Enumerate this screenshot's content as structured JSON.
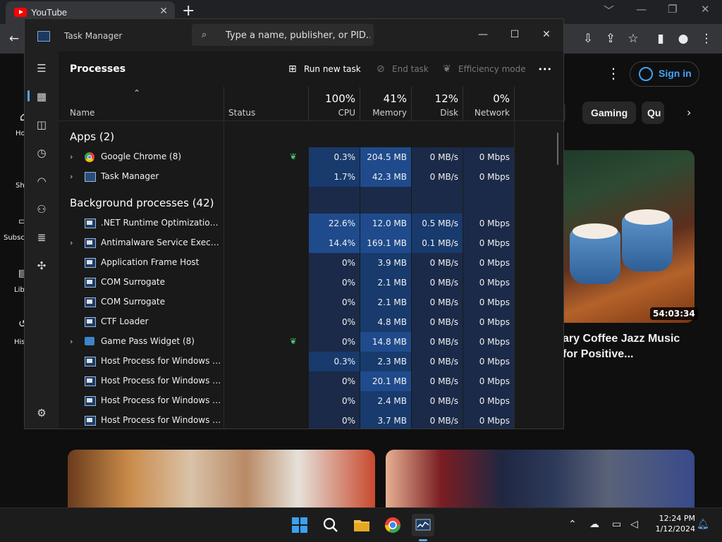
{
  "browser": {
    "tab_title": "YouTube",
    "tab_close": "✕",
    "new_tab": "+",
    "window_controls": [
      "﹀",
      "—",
      "❐",
      "✕"
    ]
  },
  "youtube": {
    "sidebar": [
      "Ho",
      "Sh",
      "Subsc",
      "Lib",
      "His"
    ],
    "signin": "Sign in",
    "chips": [
      "g",
      "Gaming",
      "Qu"
    ],
    "video": {
      "duration": "54:03:34",
      "title": "ary Coffee Jazz Music for Positive..."
    }
  },
  "taskmanager": {
    "title": "Task Manager",
    "search_placeholder": "Type a name, publisher, or PID...",
    "window_controls": [
      "—",
      "☐",
      "✕"
    ],
    "section": "Processes",
    "commands": {
      "run_new_task": "Run new task",
      "end_task": "End task",
      "efficiency_mode": "Efficiency mode",
      "more": "•••"
    },
    "headers": {
      "name": "Name",
      "status": "Status",
      "cpu_pct": "100%",
      "cpu": "CPU",
      "mem_pct": "41%",
      "mem": "Memory",
      "disk_pct": "12%",
      "disk": "Disk",
      "net_pct": "0%",
      "net": "Network"
    },
    "groups": {
      "apps": "Apps (2)",
      "background": "Background processes (42)"
    },
    "apps": [
      {
        "name": "Google Chrome (8)",
        "expand": true,
        "icon": "chrome-icon",
        "eco": true,
        "cpu": "0.3%",
        "mem": "204.5 MB",
        "disk": "0 MB/s",
        "net": "0 Mbps"
      },
      {
        "name": "Task Manager",
        "expand": true,
        "icon": "task-manager-icon",
        "eco": false,
        "cpu": "1.7%",
        "mem": "42.3 MB",
        "disk": "0 MB/s",
        "net": "0 Mbps"
      }
    ],
    "background": [
      {
        "name": ".NET Runtime Optimization Se...",
        "expand": false,
        "icon": "win",
        "eco": false,
        "cpu": "22.6%",
        "mem": "12.0 MB",
        "disk": "0.5 MB/s",
        "net": "0 Mbps"
      },
      {
        "name": "Antimalware Service Executable",
        "expand": true,
        "icon": "win",
        "eco": false,
        "cpu": "14.4%",
        "mem": "169.1 MB",
        "disk": "0.1 MB/s",
        "net": "0 Mbps"
      },
      {
        "name": "Application Frame Host",
        "expand": false,
        "icon": "win",
        "eco": false,
        "cpu": "0%",
        "mem": "3.9 MB",
        "disk": "0 MB/s",
        "net": "0 Mbps"
      },
      {
        "name": "COM Surrogate",
        "expand": false,
        "icon": "win",
        "eco": false,
        "cpu": "0%",
        "mem": "2.1 MB",
        "disk": "0 MB/s",
        "net": "0 Mbps"
      },
      {
        "name": "COM Surrogate",
        "expand": false,
        "icon": "win",
        "eco": false,
        "cpu": "0%",
        "mem": "2.1 MB",
        "disk": "0 MB/s",
        "net": "0 Mbps"
      },
      {
        "name": "CTF Loader",
        "expand": false,
        "icon": "win",
        "eco": false,
        "cpu": "0%",
        "mem": "4.8 MB",
        "disk": "0 MB/s",
        "net": "0 Mbps"
      },
      {
        "name": "Game Pass Widget (8)",
        "expand": true,
        "icon": "gp",
        "eco": true,
        "cpu": "0%",
        "mem": "14.8 MB",
        "disk": "0 MB/s",
        "net": "0 Mbps"
      },
      {
        "name": "Host Process for Windows Tasks",
        "expand": false,
        "icon": "win",
        "eco": false,
        "cpu": "0.3%",
        "mem": "2.3 MB",
        "disk": "0 MB/s",
        "net": "0 Mbps"
      },
      {
        "name": "Host Process for Windows Tasks",
        "expand": false,
        "icon": "win",
        "eco": false,
        "cpu": "0%",
        "mem": "20.1 MB",
        "disk": "0 MB/s",
        "net": "0 Mbps"
      },
      {
        "name": "Host Process for Windows Tasks",
        "expand": false,
        "icon": "win",
        "eco": false,
        "cpu": "0%",
        "mem": "2.4 MB",
        "disk": "0 MB/s",
        "net": "0 Mbps"
      },
      {
        "name": "Host Process for Windows Tasks",
        "expand": false,
        "icon": "win",
        "eco": false,
        "cpu": "0%",
        "mem": "3.7 MB",
        "disk": "0 MB/s",
        "net": "0 Mbps"
      }
    ]
  },
  "taskbar": {
    "time": "12:24 PM",
    "date": "1/12/2024"
  },
  "colors": {
    "heat_low": "#1b2a48",
    "heat_mid": "#183a6c",
    "heat_high": "#1f4b8c"
  }
}
